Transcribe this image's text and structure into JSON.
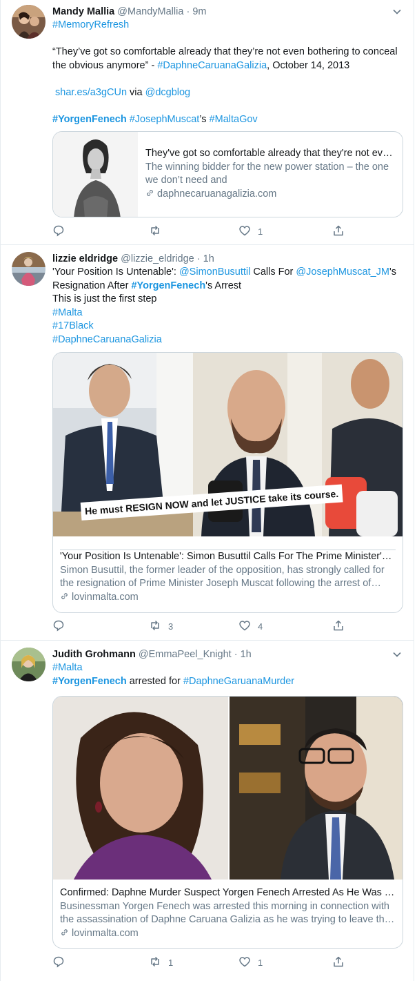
{
  "tweets": [
    {
      "name": "Mandy Mallia",
      "handle": "@MandyMallia",
      "dot": "·",
      "time": "9m",
      "lines": {
        "l1": "#MemoryRefresh",
        "quote_pre": "“They’ve got so comfortable already that they’re not even bothering to conceal the obvious anymore” - ",
        "quote_tag": "#DaphneCaruanaGalizia",
        "quote_post": ", October 14, 2013",
        "link": "shar.es/a3gCUn",
        "via": " via ",
        "via_handle": "@dcgblog",
        "tag_bold": "#YorgenFenech",
        "space": " ",
        "tag2": "#JosephMuscat",
        "poss": "’s ",
        "tag3": "#MaltaGov"
      },
      "card": {
        "title": "They've got so comfortable already that they're not even bothering to conceal the obvious anymore",
        "desc": "The winning bidder for the new power station – the one we don’t need and",
        "domain": "daphnecaruanagalizia.com"
      },
      "actions": {
        "reply": "",
        "retweet": "",
        "like": "1"
      }
    },
    {
      "name": "lizzie eldridge",
      "handle": "@lizzie_eldridge",
      "dot": "·",
      "time": "1h",
      "lines": {
        "pre": "'Your Position Is Untenable': ",
        "m1": "@SimonBusuttil",
        "mid": " Calls For ",
        "m2": "@JosephMuscat_JM",
        "poss": "'s Resignation After ",
        "btag": "#YorgenFenech",
        "post": "'s Arrest",
        "l2": "This is just the first step",
        "l3": "#Malta",
        "l4": "#17Black",
        "l5": "#DaphneCaruanaGalizia"
      },
      "card": {
        "overlay": "He must RESIGN NOW and let JUSTICE take its course.",
        "title": "'Your Position Is Untenable': Simon Busuttil Calls For The Prime Minister's Resignation",
        "desc": "Simon Busuttil, the former leader of the opposition, has strongly called for the resignation of Prime Minister Joseph Muscat following the arrest of Yorgen Fenech",
        "domain": "lovinmalta.com"
      },
      "actions": {
        "reply": "",
        "retweet": "3",
        "like": "4"
      }
    },
    {
      "name": "Judith Grohmann",
      "handle": "@EmmaPeel_Knight",
      "dot": "·",
      "time": "1h",
      "lines": {
        "l1": "#Malta",
        "btag": "#YorgenFenech",
        "mid": " arrested for ",
        "tag": "#DaphneGaruanaMurder"
      },
      "card": {
        "title": "Confirmed: Daphne Murder Suspect Yorgen Fenech Arrested As He Was Trying To Leave Malta",
        "desc": "Businessman Yorgen Fenech was arrested this morning in connection with the assassination of Daphne Caruana Galizia as he was trying to leave the island",
        "domain": "lovinmalta.com"
      },
      "actions": {
        "reply": "",
        "retweet": "1",
        "like": "1"
      }
    }
  ],
  "colors": {
    "link": "#1b95e0",
    "text": "#14171a",
    "muted": "#657786",
    "border": "#e6ecf0",
    "card_border": "#ccd6dd"
  },
  "icons": [
    "reply-icon",
    "retweet-icon",
    "like-icon",
    "share-icon",
    "chevron-down-icon",
    "link-icon"
  ]
}
